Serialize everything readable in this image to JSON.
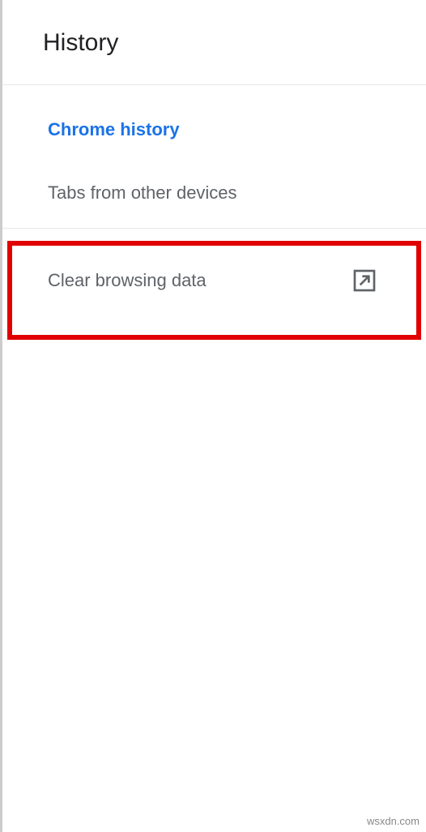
{
  "header": {
    "title": "History"
  },
  "menu": {
    "items": [
      {
        "label": "Chrome history",
        "active": true
      },
      {
        "label": "Tabs from other devices",
        "active": false
      }
    ]
  },
  "clear": {
    "label": "Clear browsing data"
  },
  "watermark": "wsxdn.com"
}
